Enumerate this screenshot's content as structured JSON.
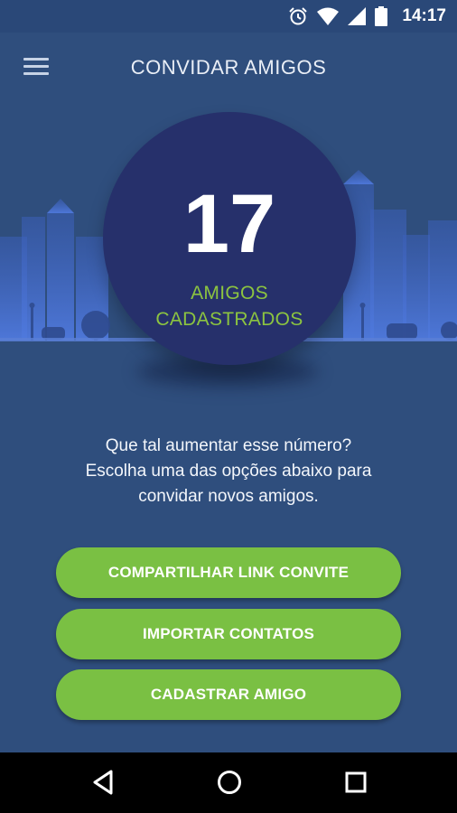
{
  "status_bar": {
    "time": "14:17",
    "icons": [
      "alarm-icon",
      "wifi-icon",
      "signal-icon",
      "battery-icon"
    ]
  },
  "app_bar": {
    "title": "CONVIDAR AMIGOS",
    "menu_icon": "hamburger-menu-icon"
  },
  "counter": {
    "value": "17",
    "label_line1": "AMIGOS",
    "label_line2": "CADASTRADOS"
  },
  "prompt": {
    "line1": "Que tal aumentar esse número?",
    "line2": "Escolha uma das opções abaixo para",
    "line3": "convidar novos amigos."
  },
  "actions": {
    "share_link": "COMPARTILHAR LINK CONVITE",
    "import_contacts": "IMPORTAR CONTATOS",
    "register_friend": "CADASTRAR AMIGO"
  },
  "nav_bar": {
    "icons": [
      "back-icon",
      "home-icon",
      "recents-icon"
    ]
  },
  "colors": {
    "background": "#2f4e7d",
    "circle": "#26306b",
    "accent_green": "#7ac043",
    "label_green": "#8cc440",
    "city_blue": "#4a6fcf"
  }
}
